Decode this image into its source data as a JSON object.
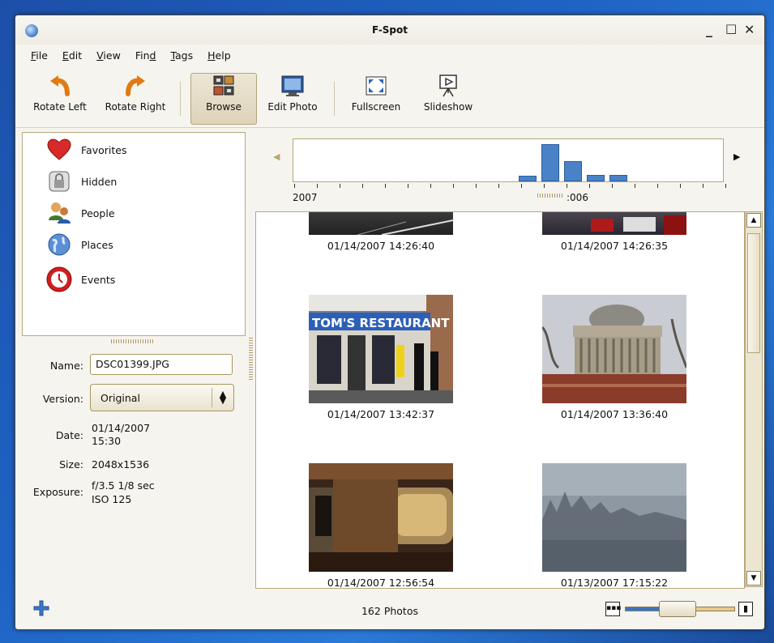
{
  "window": {
    "title": "F-Spot"
  },
  "menubar": {
    "items": [
      {
        "key": "F",
        "rest": "ile"
      },
      {
        "key": "E",
        "rest": "dit"
      },
      {
        "key": "V",
        "rest": "iew"
      },
      {
        "pre": "Fin",
        "key": "d",
        "rest": ""
      },
      {
        "key": "T",
        "rest": "ags"
      },
      {
        "key": "H",
        "rest": "elp"
      }
    ]
  },
  "toolbar": {
    "rotate_left": "Rotate Left",
    "rotate_right": "Rotate Right",
    "browse": "Browse",
    "edit_photo": "Edit Photo",
    "fullscreen": "Fullscreen",
    "slideshow": "Slideshow"
  },
  "categories": [
    "Favorites",
    "Hidden",
    "People",
    "Places",
    "Events"
  ],
  "info": {
    "name_label": "Name:",
    "name_value": "DSC01399.JPG",
    "version_label": "Version:",
    "version_value": "Original",
    "date_label": "Date:",
    "date_line1": "01/14/2007",
    "date_line2": "15:30",
    "size_label": "Size:",
    "size_value": "2048x1536",
    "exposure_label": "Exposure:",
    "exposure_line1": "f/3.5 1/8 sec",
    "exposure_line2": "ISO 125"
  },
  "timeline": {
    "label_left": "2007",
    "label_right": ":006",
    "bars": [
      0.15,
      1.0,
      0.55,
      0.18,
      0.18
    ]
  },
  "photos": [
    {
      "caption": "01/14/2007 14:26:40"
    },
    {
      "caption": "01/14/2007 14:26:35"
    },
    {
      "caption": "01/14/2007 13:42:37"
    },
    {
      "caption": "01/14/2007 13:36:40"
    },
    {
      "caption": "01/14/2007 12:56:54"
    },
    {
      "caption": "01/13/2007 17:15:22"
    }
  ],
  "photo_signs": {
    "restaurant": "TOM'S RESTAURANT"
  },
  "status": {
    "count": "162 Photos",
    "zoom_level": 0.45
  },
  "icons": {
    "add": "add-icon",
    "zoom_out": "zoom-out-icon",
    "zoom_in": "zoom-in-icon"
  }
}
